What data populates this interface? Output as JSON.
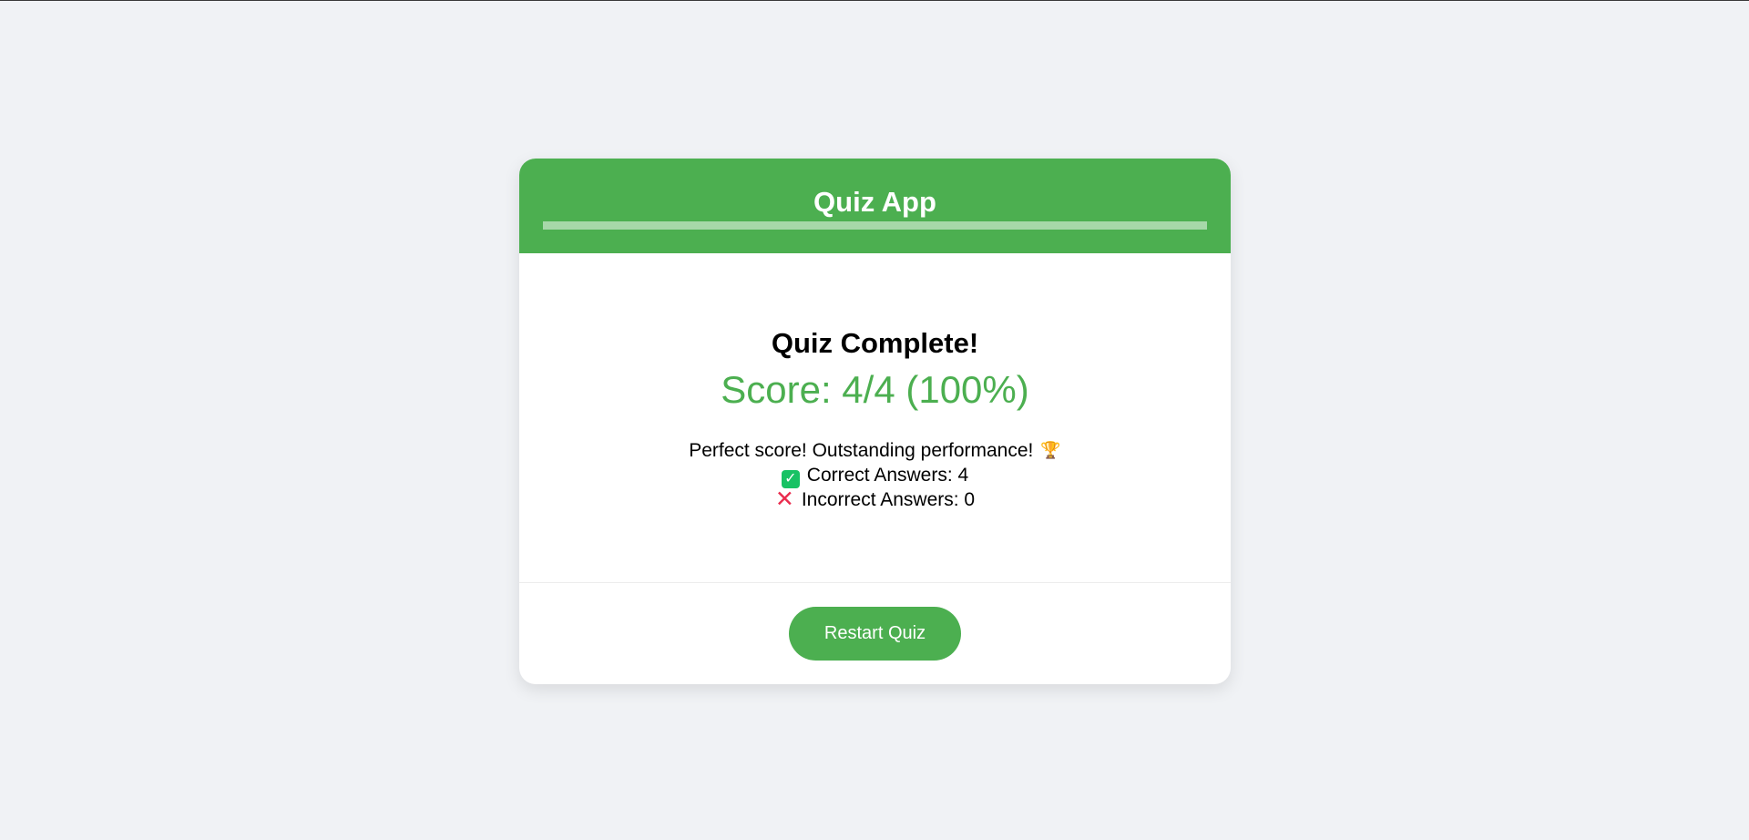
{
  "app": {
    "title": "Quiz App",
    "progress": 1.0
  },
  "result": {
    "title": "Quiz Complete!",
    "score": "Score: 4/4 (100%)",
    "message": "Perfect score! Outstanding performance!",
    "correct_label": "Correct Answers: 4",
    "incorrect_label": "Incorrect Answers: 0",
    "icons": {
      "message": "trophy-icon",
      "correct": "check-mark-icon",
      "incorrect": "cross-mark-icon"
    }
  },
  "actions": {
    "restart_label": "Restart Quiz"
  },
  "colors": {
    "accent": "#4caf50",
    "background": "#f0f2f5",
    "check": "#18c264",
    "cross": "#ea2c4e"
  }
}
